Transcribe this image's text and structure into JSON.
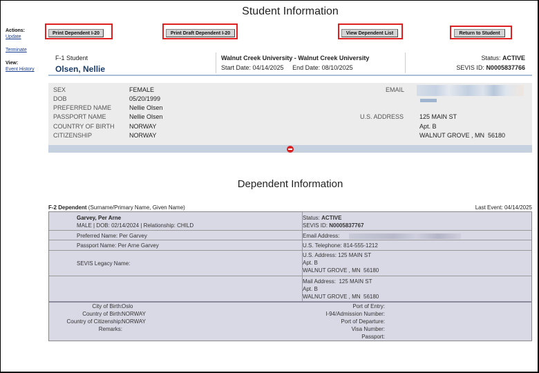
{
  "page_title": "Student Information",
  "actions": {
    "heading": "Actions:",
    "links": [
      "Update",
      "Terminate"
    ]
  },
  "view": {
    "heading": "View:",
    "links": [
      "Event History"
    ]
  },
  "buttons": {
    "print_dependent": "Print Dependent I-20",
    "print_draft": "Print Draft Dependent I-20",
    "view_list": "View Dependent List",
    "return_student": "Return to Student"
  },
  "student_header": {
    "category": "F-1 Student",
    "name": "Olsen, Nellie",
    "university": "Walnut Creek University - Walnut Creek University",
    "dates": "Start Date: 04/14/2025     End Date: 08/10/2025",
    "status_label": "Status:",
    "status_value": "ACTIVE",
    "sevis_label": "SEVIS ID:",
    "sevis_value": "N0005837766"
  },
  "student_info": {
    "sex_label": "SEX",
    "sex": "FEMALE",
    "dob_label": "DOB",
    "dob": "05/20/1999",
    "preferred_label": "PREFERRED NAME",
    "preferred": "Nellie Olsen",
    "passport_label": "PASSPORT NAME",
    "passport": "Nellie Olsen",
    "cob_label": "COUNTRY OF BIRTH",
    "cob": "NORWAY",
    "cit_label": "CITIZENSHIP",
    "cit": "NORWAY",
    "email_label": "EMAIL",
    "us_address_label": "U.S. ADDRESS",
    "address_line1": "125 MAIN ST",
    "address_line2": "Apt. B",
    "address_line3": "WALNUT GROVE , MN  56180"
  },
  "dependent_section_title": "Dependent Information",
  "dependent_header": {
    "type": "F-2 Dependent",
    "hint": "(Surname/Primary Name, Given Name)",
    "last_event": "Last Event: 04/14/2025"
  },
  "dependent": {
    "name": "Garvey, Per Arne",
    "summary": "MALE | DOB: 02/14/2024 | Relationship: CHILD",
    "status_label": "Status:",
    "status_value": "ACTIVE",
    "sevis_label": "SEVIS ID:",
    "sevis_value": "N0005837767",
    "preferred": "Preferred Name: Per Garvey",
    "email_label": "Email Address:",
    "passport": "Passport Name: Per Arne Garvey",
    "telephone": "U.S. Telephone: 814-555-1212",
    "legacy": "SEVIS Legacy Name:",
    "us_address_1": "U.S. Address: 125 MAIN ST",
    "us_address_2": "Apt. B",
    "us_address_3": "WALNUT GROVE , MN  56180",
    "mail_address_1": "Mail Address:  125 MAIN ST",
    "mail_address_2": "Apt. B",
    "mail_address_3": "WALNUT GROVE , MN  56180",
    "city_label": "City of Birth:",
    "city": "Oslo",
    "cob_label": "Country of Birth:",
    "cob": "NORWAY",
    "coc_label": "Country of Citizenship:",
    "coc": "NORWAY",
    "remarks_label": "Remarks:",
    "port_entry": "Port of Entry:",
    "i94": "I-94/Admission Number:",
    "port_departure": "Port of Departure:",
    "visa": "Visa Number:",
    "passport_num": "Passport:"
  },
  "colors": {
    "highlight_box": "#e02020",
    "name_blue": "#1a3d6e",
    "panel_gray": "#ececec",
    "dependent_table": "#d9d9e6"
  }
}
